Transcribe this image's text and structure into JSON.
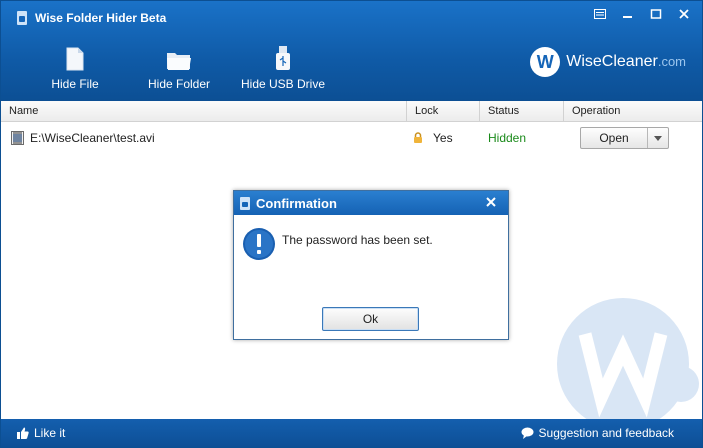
{
  "window": {
    "title": "Wise Folder Hider Beta"
  },
  "toolbar": {
    "hide_file": "Hide File",
    "hide_folder": "Hide Folder",
    "hide_usb": "Hide USB Drive"
  },
  "brand": {
    "name": "WiseCleaner",
    "suffix": ".com",
    "logo_letter": "W"
  },
  "table": {
    "headers": [
      "Name",
      "Lock",
      "Status",
      "Operation"
    ],
    "rows": [
      {
        "name": "E:\\WiseCleaner\\test.avi",
        "lock": "Yes",
        "status": "Hidden",
        "operation": "Open"
      }
    ]
  },
  "footer": {
    "like": "Like it",
    "feedback": "Suggestion and feedback"
  },
  "dialog": {
    "title": "Confirmation",
    "message": "The password has been set.",
    "ok": "Ok"
  },
  "colors": {
    "header_blue": "#1565b8",
    "status_green": "#1a8a1a",
    "footer_blue": "#0f57a2"
  }
}
